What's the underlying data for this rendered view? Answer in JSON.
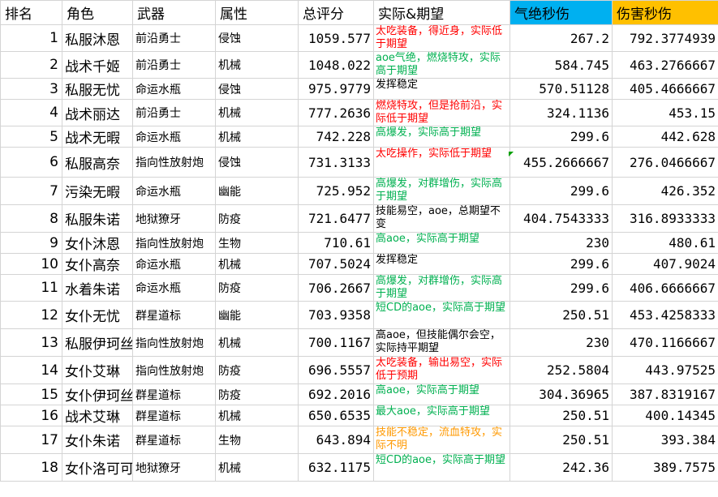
{
  "headers": {
    "rank": "排名",
    "character": "角色",
    "weapon": "武器",
    "attribute": "属性",
    "total_score": "总评分",
    "actual_vs_expected": "实际&期望",
    "qijue_dps": "气绝秒伤",
    "damage_dps": "伤害秒伤"
  },
  "colors": {
    "qijue_header": "#00b0f0",
    "damage_header": "#ffc000",
    "note_red": "#ff0000",
    "note_green": "#00b050",
    "note_amber": "#ff9900",
    "grid": "#d4d4d4"
  },
  "rows": [
    {
      "rank": "1",
      "character": "私服沐恩",
      "weapon": "前沿勇士",
      "attribute": "侵蚀",
      "total_score": "1059.577",
      "note": "太吃装备，得近身，实际低于期望",
      "note_color": "red",
      "qijue_dps": "267.2",
      "damage_dps": "792.3774939"
    },
    {
      "rank": "2",
      "character": "战术千姬",
      "weapon": "前沿勇士",
      "attribute": "机械",
      "total_score": "1048.022",
      "note": "aoe气绝，燃烧特攻，实际高于期望",
      "note_color": "green",
      "qijue_dps": "584.745",
      "damage_dps": "463.2766667"
    },
    {
      "rank": "3",
      "character": "私服无忧",
      "weapon": "命运水瓶",
      "attribute": "侵蚀",
      "total_score": "975.9779",
      "note": "发挥稳定",
      "note_color": "black",
      "qijue_dps": "570.51128",
      "damage_dps": "405.4666667"
    },
    {
      "rank": "4",
      "character": "战术丽达",
      "weapon": "前沿勇士",
      "attribute": "机械",
      "total_score": "777.2636",
      "note": "燃烧特攻，但是抢前沿，实际低于期望",
      "note_color": "red",
      "qijue_dps": "324.1136",
      "damage_dps": "453.15"
    },
    {
      "rank": "5",
      "character": "战术无暇",
      "weapon": "命运水瓶",
      "attribute": "机械",
      "total_score": "742.228",
      "note": "高爆发，实际高于期望",
      "note_color": "green",
      "qijue_dps": "299.6",
      "damage_dps": "442.628"
    },
    {
      "rank": "6",
      "character": "私服高奈",
      "weapon": "指向性放射炮",
      "attribute": "侵蚀",
      "total_score": "731.3133",
      "note": "太吃操作，实际低于期望",
      "note_color": "red",
      "qijue_dps": "455.2666667",
      "damage_dps": "276.0466667"
    },
    {
      "rank": "7",
      "character": "污染无暇",
      "weapon": "命运水瓶",
      "attribute": "幽能",
      "total_score": "725.952",
      "note": "高爆发，对群增伤，实际高于期望",
      "note_color": "green",
      "qijue_dps": "299.6",
      "damage_dps": "426.352"
    },
    {
      "rank": "8",
      "character": "私服朱诺",
      "weapon": "地狱獠牙",
      "attribute": "防疫",
      "total_score": "721.6477",
      "note": "技能易空，aoe，总期望不变",
      "note_color": "black",
      "qijue_dps": "404.7543333",
      "damage_dps": "316.8933333"
    },
    {
      "rank": "9",
      "character": "女仆沐恩",
      "weapon": "指向性放射炮",
      "attribute": "生物",
      "total_score": "710.61",
      "note": "高aoe，实际高于期望",
      "note_color": "green",
      "qijue_dps": "230",
      "damage_dps": "480.61"
    },
    {
      "rank": "10",
      "character": "女仆高奈",
      "weapon": "命运水瓶",
      "attribute": "机械",
      "total_score": "707.5024",
      "note": "发挥稳定",
      "note_color": "black",
      "qijue_dps": "299.6",
      "damage_dps": "407.9024"
    },
    {
      "rank": "11",
      "character": "水着朱诺",
      "weapon": "命运水瓶",
      "attribute": "防疫",
      "total_score": "706.2667",
      "note": "高爆发，对群增伤，实际高于期望",
      "note_color": "green",
      "qijue_dps": "299.6",
      "damage_dps": "406.6666667"
    },
    {
      "rank": "12",
      "character": "女仆无忧",
      "weapon": "群星道标",
      "attribute": "幽能",
      "total_score": "703.9358",
      "note": "短CD的aoe，实际高于期望",
      "note_color": "green",
      "qijue_dps": "250.51",
      "damage_dps": "453.4258333"
    },
    {
      "rank": "13",
      "character": "私服伊珂丝",
      "weapon": "指向性放射炮",
      "attribute": "机械",
      "total_score": "700.1167",
      "note": "高aoe，但技能偶尔会空，实际持平期望",
      "note_color": "black",
      "qijue_dps": "230",
      "damage_dps": "470.1166667"
    },
    {
      "rank": "14",
      "character": "女仆艾琳",
      "weapon": "指向性放射炮",
      "attribute": "防疫",
      "total_score": "696.5557",
      "note": "太吃装备，输出易空，实际低于预期",
      "note_color": "red",
      "qijue_dps": "252.5804",
      "damage_dps": "443.97525"
    },
    {
      "rank": "15",
      "character": "女仆伊珂丝",
      "weapon": "群星道标",
      "attribute": "防疫",
      "total_score": "692.2016",
      "note": "高aoe，实际高于期望",
      "note_color": "green",
      "qijue_dps": "304.36965",
      "damage_dps": "387.8319167"
    },
    {
      "rank": "16",
      "character": "战术艾琳",
      "weapon": "群星道标",
      "attribute": "机械",
      "total_score": "650.6535",
      "note": "最大aoe，实际高于期望",
      "note_color": "green",
      "qijue_dps": "250.51",
      "damage_dps": "400.14345"
    },
    {
      "rank": "17",
      "character": "女仆朱诺",
      "weapon": "群星道标",
      "attribute": "生物",
      "total_score": "643.894",
      "note": "技能不稳定，流血特攻，实际不明",
      "note_color": "amber",
      "qijue_dps": "250.51",
      "damage_dps": "393.384"
    },
    {
      "rank": "18",
      "character": "女仆洛可可",
      "weapon": "地狱獠牙",
      "attribute": "机械",
      "total_score": "632.1175",
      "note": "短CD的aoe，实际高于期望",
      "note_color": "green",
      "qijue_dps": "242.36",
      "damage_dps": "389.7575"
    }
  ]
}
